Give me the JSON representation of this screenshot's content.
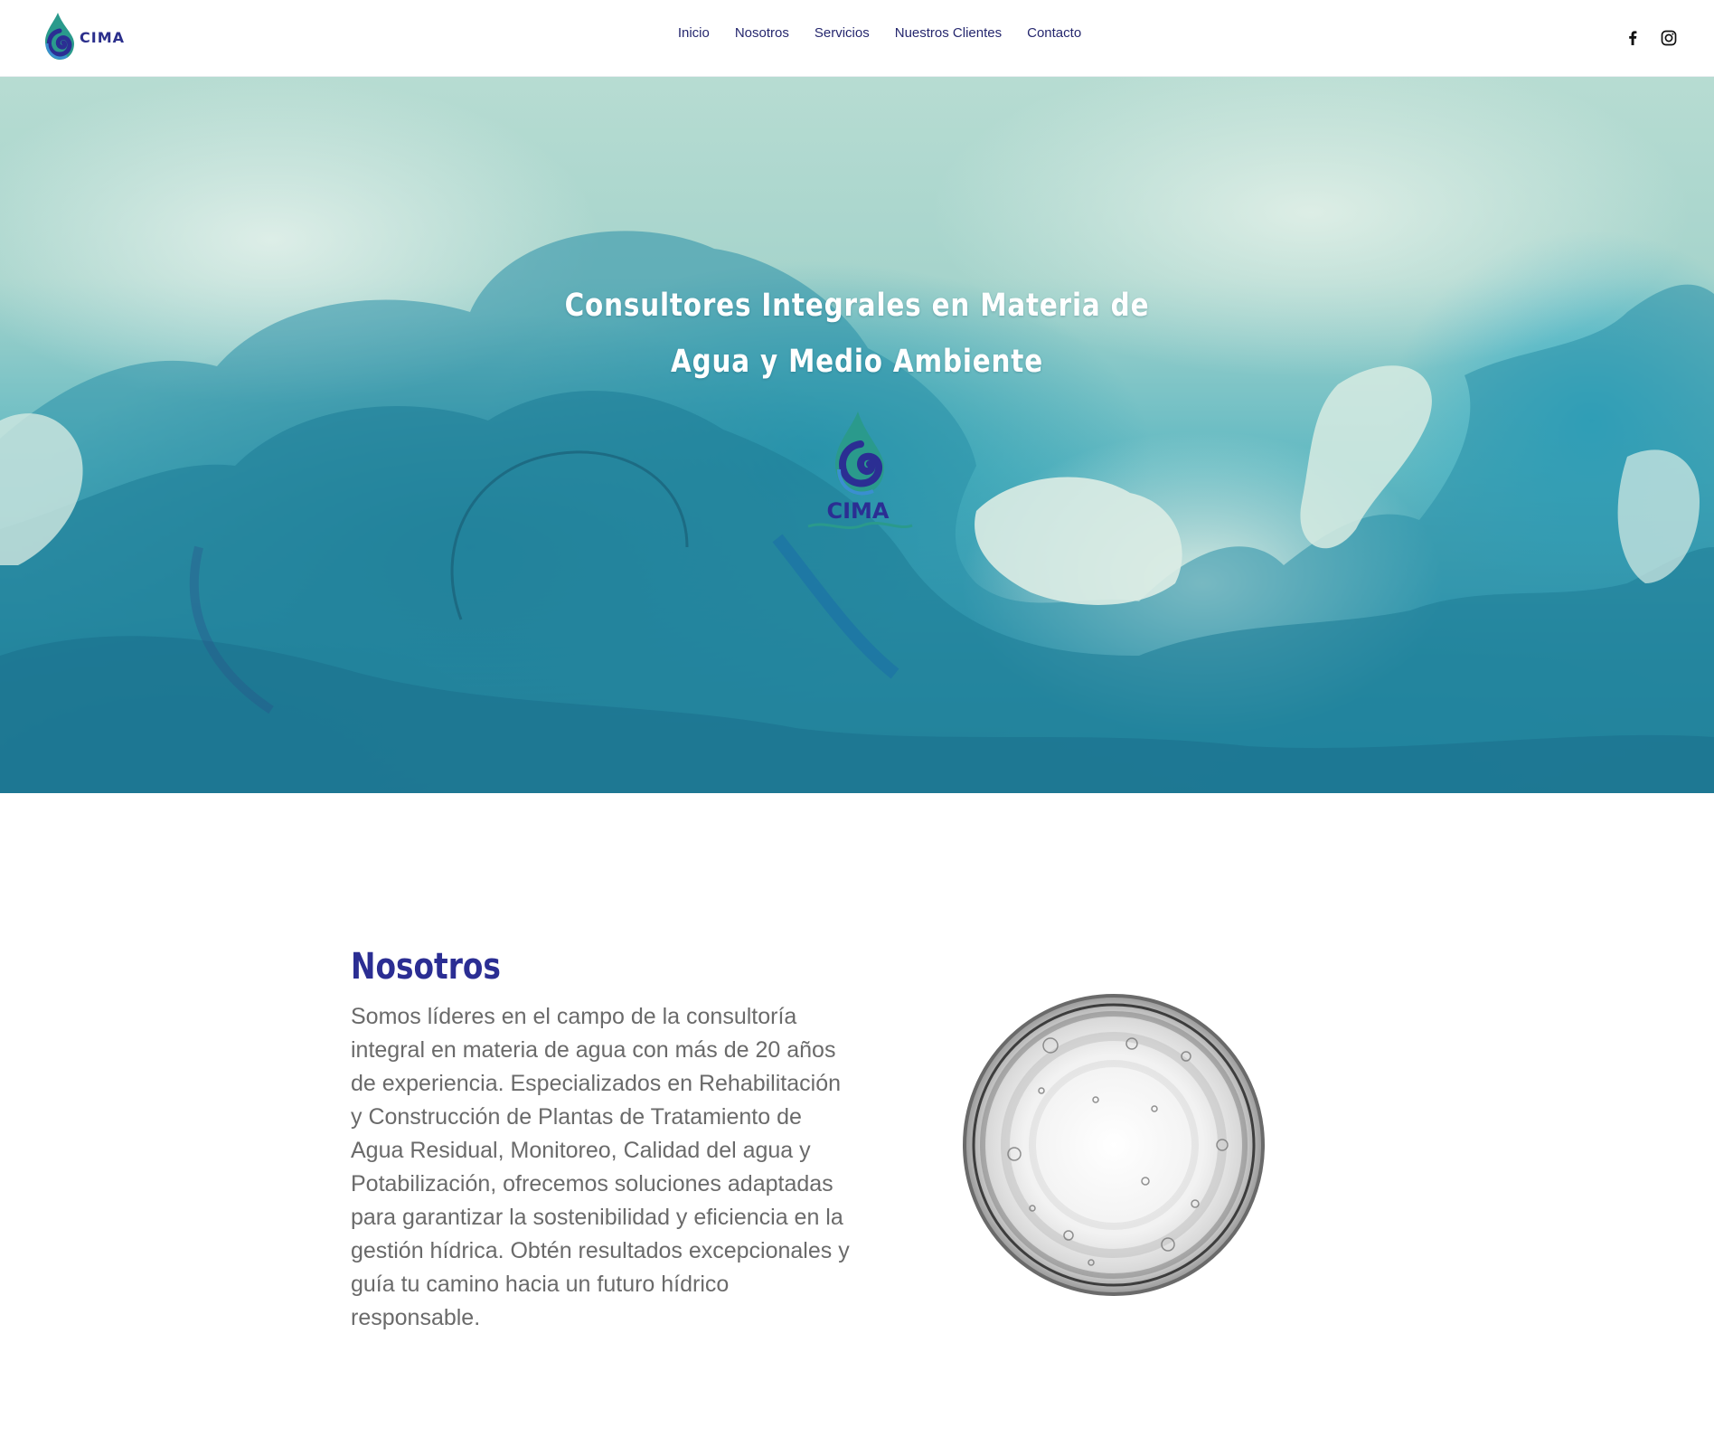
{
  "header": {
    "logo_text": "CIMA",
    "nav": [
      "Inicio",
      "Nosotros",
      "Servicios",
      "Nuestros Clientes",
      "Contacto"
    ],
    "social": [
      "facebook-icon",
      "instagram-icon"
    ]
  },
  "hero": {
    "title": "Consultores Integrales en Materia de Agua y Medio Ambiente",
    "logo_text": "CIMA"
  },
  "about": {
    "title": "Nosotros",
    "text": "Somos líderes en el campo de la consultoría integral en materia de agua con más de 20 años de experiencia. Especializados en Rehabilitación y Construcción de Plantas de Tratamiento de Agua Residual, Monitoreo, Calidad del agua y Potabilización, ofrecemos soluciones adaptadas para garantizar la sostenibilidad y eficiencia en la gestión hídrica. Obtén resultados excepcionales y guía tu camino hacia un futuro hídrico responsable."
  },
  "colors": {
    "brand_blue": "#2b2e93",
    "nav_text": "#25276e",
    "body_text": "#6a6a6a",
    "teal": "#2f93ad"
  }
}
